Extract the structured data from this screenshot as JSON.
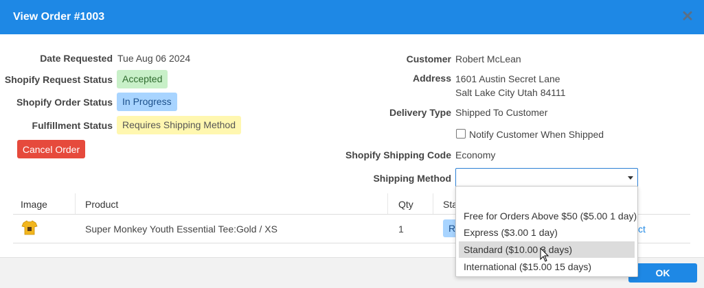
{
  "window": {
    "title": "View Order #1003",
    "accent_color": "#1e88e5"
  },
  "order": {
    "date_label": "Date Requested",
    "date_value": "Tue Aug 06 2024",
    "shopify_request_status_label": "Shopify Request Status",
    "shopify_request_status_value": "Accepted",
    "shopify_order_status_label": "Shopify Order Status",
    "shopify_order_status_value": "In Progress",
    "fulfillment_status_label": "Fulfillment Status",
    "fulfillment_status_value": "Requires Shipping Method",
    "cancel_label": "Cancel Order"
  },
  "customer": {
    "customer_label": "Customer",
    "customer_value": "Robert McLean",
    "address_label": "Address",
    "address_line1": "1601 Austin Secret Lane",
    "address_line2": "Salt Lake City Utah 84111",
    "delivery_type_label": "Delivery Type",
    "delivery_type_value": "Shipped To Customer",
    "notify_label": "Notify Customer When Shipped",
    "notify_checked": false,
    "shipping_code_label": "Shopify Shipping Code",
    "shipping_code_value": "Economy",
    "shipping_method_label": "Shipping Method",
    "shipping_method_value": ""
  },
  "shipping_dropdown": {
    "options": [
      "",
      "Free for Orders Above $50 ($5.00 1 day)",
      "Express ($3.00 1 day)",
      "Standard ($10.00 3 days)",
      "International ($15.00 15 days)"
    ],
    "highlighted": "Standard ($10.00 3 days)"
  },
  "table": {
    "headers": [
      "Image",
      "Product",
      "Qty",
      "Sta"
    ],
    "rows": [
      {
        "image_icon": "tshirt-icon",
        "product": "Super Monkey Youth Essential Tee:Gold / XS",
        "qty": "1",
        "status_fragment": "R",
        "link_fragment": "ct"
      }
    ]
  },
  "footer": {
    "ok_label": "OK"
  },
  "icons": {
    "close": "close-icon",
    "caret": "chevron-down-icon",
    "cursor": "mouse-cursor-icon"
  }
}
